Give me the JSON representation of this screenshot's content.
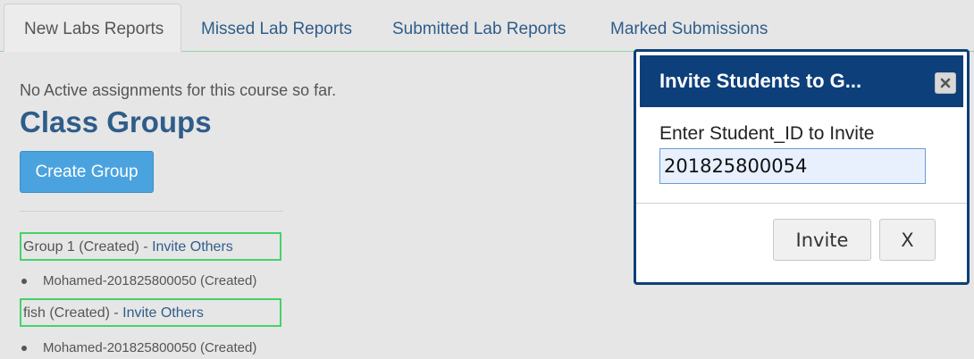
{
  "tabs": [
    {
      "label": "New Labs Reports",
      "active": true
    },
    {
      "label": "Missed Lab Reports",
      "active": false
    },
    {
      "label": "Submitted Lab Reports",
      "active": false
    },
    {
      "label": "Marked Submissions",
      "active": false
    }
  ],
  "main": {
    "no_assignments_msg": "No Active assignments for this course so far.",
    "title": "Class Groups",
    "create_group_label": "Create Group",
    "groups": [
      {
        "name": "Group 1 (Created) - ",
        "invite_label": "Invite Others",
        "members": [
          "Mohamed-201825800050 (Created)"
        ]
      },
      {
        "name": "fish (Created) - ",
        "invite_label": "Invite Others",
        "members": [
          "Mohamed-201825800050 (Created)"
        ]
      }
    ]
  },
  "modal": {
    "title": "Invite Students to G...",
    "close_icon": "close-icon",
    "field_label": "Enter Student_ID to Invite",
    "field_value": "201825800054",
    "invite_label": "Invite",
    "cancel_label": "X"
  },
  "colors": {
    "accent": "#2f5d8a",
    "modal_header": "#0d3f7a",
    "primary_button": "#4aa3df",
    "highlight_box": "#44d36a",
    "tab_underline": "#8fd3a8",
    "background": "#e6e6e6"
  }
}
